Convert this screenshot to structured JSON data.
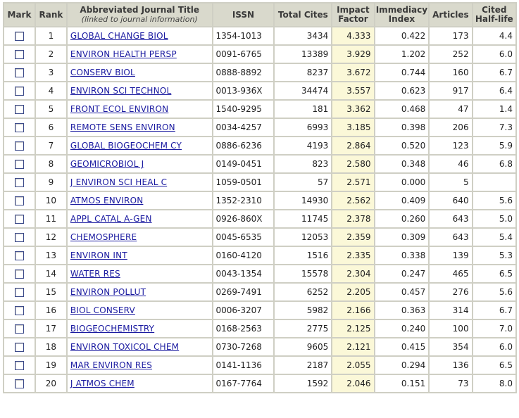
{
  "headers": {
    "mark": "Mark",
    "rank": "Rank",
    "title": "Abbreviated Journal Title",
    "title_sub": "(linked to journal information)",
    "issn": "ISSN",
    "total_cites": "Total Cites",
    "impact_factor_1": "Impact",
    "impact_factor_2": "Factor",
    "immediacy_1": "Immediacy",
    "immediacy_2": "Index",
    "articles": "Articles",
    "half_life_1": "Cited",
    "half_life_2": "Half-life"
  },
  "rows": [
    {
      "rank": "1",
      "title": "GLOBAL CHANGE BIOL",
      "issn": "1354-1013",
      "cites": "3434",
      "impact": "4.333",
      "immediacy": "0.422",
      "articles": "173",
      "halflife": "4.4"
    },
    {
      "rank": "2",
      "title": "ENVIRON HEALTH PERSP",
      "issn": "0091-6765",
      "cites": "13389",
      "impact": "3.929",
      "immediacy": "1.202",
      "articles": "252",
      "halflife": "6.0"
    },
    {
      "rank": "3",
      "title": "CONSERV BIOL",
      "issn": "0888-8892",
      "cites": "8237",
      "impact": "3.672",
      "immediacy": "0.744",
      "articles": "160",
      "halflife": "6.7"
    },
    {
      "rank": "4",
      "title": "ENVIRON SCI TECHNOL",
      "issn": "0013-936X",
      "cites": "34474",
      "impact": "3.557",
      "immediacy": "0.623",
      "articles": "917",
      "halflife": "6.4"
    },
    {
      "rank": "5",
      "title": "FRONT ECOL ENVIRON",
      "issn": "1540-9295",
      "cites": "181",
      "impact": "3.362",
      "immediacy": "0.468",
      "articles": "47",
      "halflife": "1.4"
    },
    {
      "rank": "6",
      "title": "REMOTE SENS ENVIRON",
      "issn": "0034-4257",
      "cites": "6993",
      "impact": "3.185",
      "immediacy": "0.398",
      "articles": "206",
      "halflife": "7.3"
    },
    {
      "rank": "7",
      "title": "GLOBAL BIOGEOCHEM CY",
      "issn": "0886-6236",
      "cites": "4193",
      "impact": "2.864",
      "immediacy": "0.520",
      "articles": "123",
      "halflife": "5.9"
    },
    {
      "rank": "8",
      "title": "GEOMICROBIOL J",
      "issn": "0149-0451",
      "cites": "823",
      "impact": "2.580",
      "immediacy": "0.348",
      "articles": "46",
      "halflife": "6.8"
    },
    {
      "rank": "9",
      "title": "J ENVIRON SCI HEAL C",
      "issn": "1059-0501",
      "cites": "57",
      "impact": "2.571",
      "immediacy": "0.000",
      "articles": "5",
      "halflife": ""
    },
    {
      "rank": "10",
      "title": "ATMOS ENVIRON",
      "issn": "1352-2310",
      "cites": "14930",
      "impact": "2.562",
      "immediacy": "0.409",
      "articles": "640",
      "halflife": "5.6"
    },
    {
      "rank": "11",
      "title": "APPL CATAL A-GEN",
      "issn": "0926-860X",
      "cites": "11745",
      "impact": "2.378",
      "immediacy": "0.260",
      "articles": "643",
      "halflife": "5.0"
    },
    {
      "rank": "12",
      "title": "CHEMOSPHERE",
      "issn": "0045-6535",
      "cites": "12053",
      "impact": "2.359",
      "immediacy": "0.309",
      "articles": "643",
      "halflife": "5.4"
    },
    {
      "rank": "13",
      "title": "ENVIRON INT",
      "issn": "0160-4120",
      "cites": "1516",
      "impact": "2.335",
      "immediacy": "0.338",
      "articles": "139",
      "halflife": "5.3"
    },
    {
      "rank": "14",
      "title": "WATER RES",
      "issn": "0043-1354",
      "cites": "15578",
      "impact": "2.304",
      "immediacy": "0.247",
      "articles": "465",
      "halflife": "6.5"
    },
    {
      "rank": "15",
      "title": "ENVIRON POLLUT",
      "issn": "0269-7491",
      "cites": "6252",
      "impact": "2.205",
      "immediacy": "0.457",
      "articles": "276",
      "halflife": "5.6"
    },
    {
      "rank": "16",
      "title": "BIOL CONSERV",
      "issn": "0006-3207",
      "cites": "5982",
      "impact": "2.166",
      "immediacy": "0.363",
      "articles": "314",
      "halflife": "6.7"
    },
    {
      "rank": "17",
      "title": "BIOGEOCHEMISTRY",
      "issn": "0168-2563",
      "cites": "2775",
      "impact": "2.125",
      "immediacy": "0.240",
      "articles": "100",
      "halflife": "7.0"
    },
    {
      "rank": "18",
      "title": "ENVIRON TOXICOL CHEM",
      "issn": "0730-7268",
      "cites": "9605",
      "impact": "2.121",
      "immediacy": "0.415",
      "articles": "354",
      "halflife": "6.0"
    },
    {
      "rank": "19",
      "title": "MAR ENVIRON RES",
      "issn": "0141-1136",
      "cites": "2187",
      "impact": "2.055",
      "immediacy": "0.294",
      "articles": "136",
      "halflife": "6.5"
    },
    {
      "rank": "20",
      "title": "J ATMOS CHEM",
      "issn": "0167-7764",
      "cites": "1592",
      "impact": "2.046",
      "immediacy": "0.151",
      "articles": "73",
      "halflife": "8.0"
    }
  ],
  "colors": {
    "header_bg": "#d9d9cc",
    "grid": "#cfcfc4",
    "impact_bg": "#fbf8d8",
    "link": "#1a1aa0"
  }
}
